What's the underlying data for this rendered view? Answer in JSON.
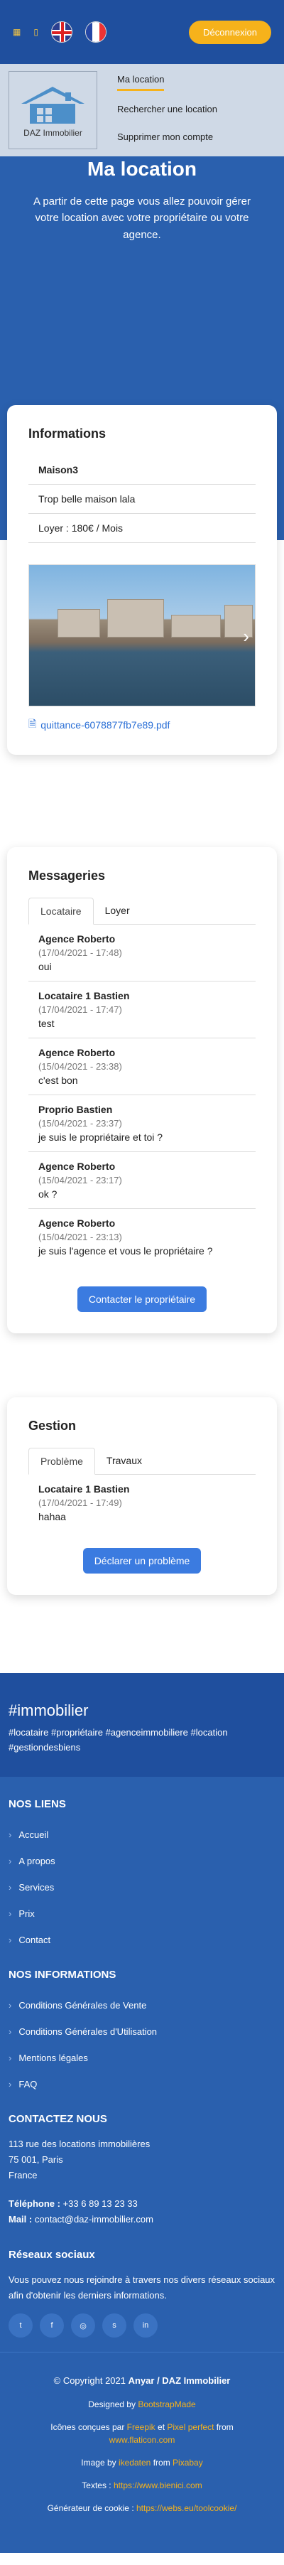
{
  "topbar": {
    "logout_label": "Déconnexion"
  },
  "nav": {
    "logo_text": "DAZ Immobilier",
    "links": [
      "Ma location",
      "Rechercher une location",
      "Supprimer mon compte"
    ]
  },
  "hero": {
    "title": "Ma location",
    "subtitle": "A partir de cette page vous allez pouvoir gérer votre location avec votre propriétaire ou votre agence."
  },
  "informations": {
    "title": "Informations",
    "name": "Maison3",
    "description": "Trop belle maison lala",
    "rent": "Loyer : 180€ / Mois",
    "file_name": "quittance-6078877fb7e89.pdf"
  },
  "messages": {
    "title": "Messageries",
    "tabs": [
      "Locataire",
      "Loyer"
    ],
    "items": [
      {
        "author": "Agence Roberto",
        "date": "(17/04/2021 - 17:48)",
        "text": "oui"
      },
      {
        "author": "Locataire 1 Bastien",
        "date": "(17/04/2021 - 17:47)",
        "text": "test"
      },
      {
        "author": "Agence Roberto",
        "date": "(15/04/2021 - 23:38)",
        "text": "c'est bon"
      },
      {
        "author": "Proprio Bastien",
        "date": "(15/04/2021 - 23:37)",
        "text": "je suis le propriétaire et toi ?"
      },
      {
        "author": "Agence Roberto",
        "date": "(15/04/2021 - 23:17)",
        "text": "ok ?"
      },
      {
        "author": "Agence Roberto",
        "date": "(15/04/2021 - 23:13)",
        "text": "je suis l'agence et vous le propriétaire ?"
      }
    ],
    "contact_button": "Contacter le propriétaire"
  },
  "gestion": {
    "title": "Gestion",
    "tabs": [
      "Problème",
      "Travaux"
    ],
    "item": {
      "author": "Locataire 1 Bastien",
      "date": "(17/04/2021 - 17:49)",
      "text": "hahaa"
    },
    "declare_button": "Déclarer un problème"
  },
  "footer": {
    "hash_title": "#immobilier",
    "hash_tags": "#locataire #propriétaire #agenceimmobiliere #location #gestiondesbiens",
    "links_title": "NOS LIENS",
    "links": [
      "Accueil",
      "A propos",
      "Services",
      "Prix",
      "Contact"
    ],
    "info_title": "NOS INFORMATIONS",
    "info_links": [
      "Conditions Générales de Vente",
      "Conditions Générales d'Utilisation",
      "Mentions légales",
      "FAQ"
    ],
    "contact_title": "CONTACTEZ NOUS",
    "address_line1": "113 rue des locations immobilières",
    "address_line2": "75 001, Paris",
    "address_line3": "France",
    "phone_label": "Téléphone :",
    "phone": "+33 6 89 13 23 33",
    "mail_label": "Mail :",
    "mail": "contact@daz-immobilier.com",
    "social_title": "Réseaux sociaux",
    "social_text": "Vous pouvez nous rejoindre à travers nos divers réseaux sociaux afin d'obtenir les derniers informations.",
    "social_icons": [
      "twitter-icon",
      "facebook-icon",
      "instagram-icon",
      "skype-icon",
      "linkedin-icon"
    ],
    "copyright_prefix": "© Copyright 2021",
    "copyright_brand": "Anyar / DAZ Immobilier",
    "designed_by_prefix": "Designed by",
    "designed_by": "BootstrapMade",
    "icons_prefix": "Icônes conçues par",
    "icons_author1": "Freepik",
    "icons_mid": "et",
    "icons_author2": "Pixel perfect",
    "icons_from": "from",
    "icons_site": "www.flaticon.com",
    "image_prefix": "Image by",
    "image_author": "ikedaten",
    "image_from": "from",
    "image_site": "Pixabay",
    "texts_prefix": "Textes :",
    "texts_site": "https://www.bienici.com",
    "cookie_prefix": "Générateur de cookie :",
    "cookie_site": "https://webs.eu/toolcookie/"
  }
}
